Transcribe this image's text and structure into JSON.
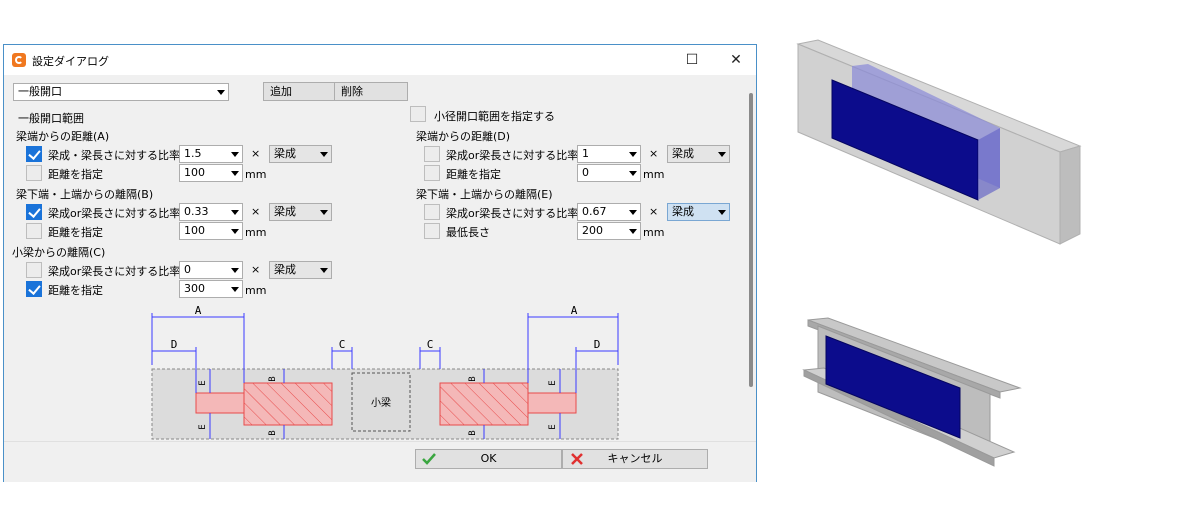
{
  "window": {
    "title": "設定ダイアログ",
    "maximize_glyph": "☐",
    "close_glyph": "✕"
  },
  "top": {
    "preset_value": "一般開口",
    "add_label": "追加",
    "delete_label": "削除"
  },
  "left": {
    "section_title": "一般開口範囲",
    "group_a": {
      "title": "梁端からの距離(A)",
      "ratio_label": "梁成・梁長さに対する比率",
      "ratio_checked": true,
      "ratio_value": "1.5",
      "times": "×",
      "base_value": "梁成",
      "dist_label": "距離を指定",
      "dist_checked": false,
      "dist_value": "100",
      "unit": "mm"
    },
    "group_b": {
      "title": "梁下端・上端からの離隔(B)",
      "ratio_label": "梁成or梁長さに対する比率",
      "ratio_checked": true,
      "ratio_value": "0.33",
      "times": "×",
      "base_value": "梁成",
      "dist_label": "距離を指定",
      "dist_checked": false,
      "dist_value": "100",
      "unit": "mm"
    },
    "group_c": {
      "title": "小梁からの離隔(C)",
      "ratio_label": "梁成or梁長さに対する比率",
      "ratio_checked": false,
      "ratio_value": "0",
      "times": "×",
      "base_value": "梁成",
      "dist_label": "距離を指定",
      "dist_checked": true,
      "dist_value": "300",
      "unit": "mm"
    }
  },
  "right": {
    "small_check_label": "小径開口範囲を指定する",
    "small_checked": false,
    "group_d": {
      "title": "梁端からの距離(D)",
      "ratio_label": "梁成or梁長さに対する比率",
      "ratio_checked": false,
      "ratio_value": "1",
      "times": "×",
      "base_value": "梁成",
      "dist_label": "距離を指定",
      "dist_checked": false,
      "dist_value": "0",
      "unit": "mm"
    },
    "group_e": {
      "title": "梁下端・上端からの離隔(E)",
      "ratio_label": "梁成or梁長さに対する比率",
      "ratio_checked": false,
      "ratio_value": "0.67",
      "times": "×",
      "base_value": "梁成",
      "min_label": "最低長さ",
      "min_checked": false,
      "min_value": "200",
      "unit": "mm"
    }
  },
  "diagram": {
    "label_a": "A",
    "label_d": "D",
    "label_c": "C",
    "label_b": "B",
    "label_e": "E",
    "small_beam_label": "小梁"
  },
  "footer": {
    "ok_label": "OK",
    "cancel_label": "キャンセル"
  },
  "colors": {
    "accent": "#1a73d9",
    "opening_fill": "#f4b8b8",
    "opening_stroke": "#e84a4a",
    "dim_line": "#3a3aff",
    "box_blue": "#0c0c8c"
  }
}
